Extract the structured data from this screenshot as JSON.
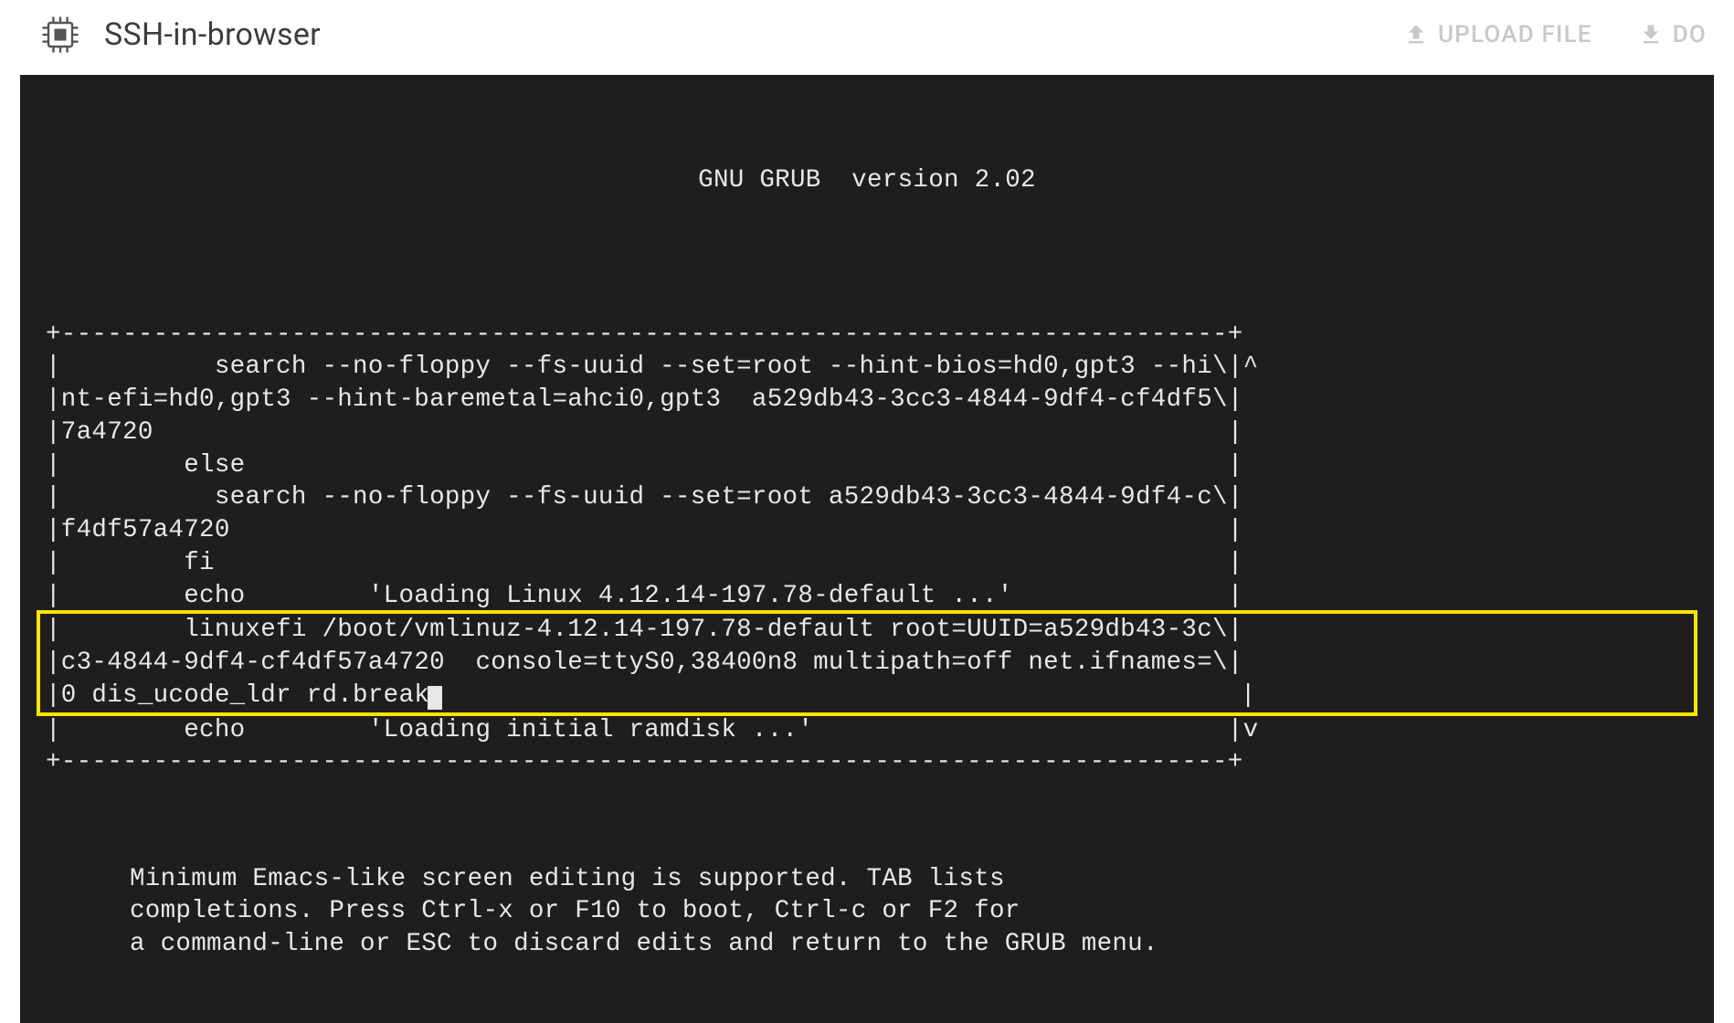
{
  "header": {
    "title": "SSH-in-browser",
    "upload_label": "UPLOAD FILE",
    "download_label": "DO"
  },
  "terminal": {
    "grub_title": "GNU GRUB  version 2.02",
    "border_top": "+----------------------------------------------------------------------------+",
    "line1": "|          search --no-floppy --fs-uuid --set=root --hint-bios=hd0,gpt3 --hi\\|^",
    "line2": "|nt-efi=hd0,gpt3 --hint-baremetal=ahci0,gpt3  a529db43-3cc3-4844-9df4-cf4df5\\|",
    "line3": "|7a4720                                                                      |",
    "line4": "|        else                                                                |",
    "line5": "|          search --no-floppy --fs-uuid --set=root a529db43-3cc3-4844-9df4-c\\|",
    "line6": "|f4df57a4720                                                                 |",
    "line7": "|        fi                                                                  |",
    "line8": "|        echo        'Loading Linux 4.12.14-197.78-default ...'              |",
    "hl1": "|        linuxefi /boot/vmlinuz-4.12.14-197.78-default root=UUID=a529db43-3c\\|",
    "hl2": "|c3-4844-9df4-cf4df57a4720  console=ttyS0,38400n8 multipath=off net.ifnames=\\|",
    "hl3": "|0 dis_ucode_ldr rd.break",
    "hl3_end": "                                                    |",
    "line12": "|        echo        'Loading initial ramdisk ...'                           |v",
    "border_bottom": "+----------------------------------------------------------------------------+",
    "help1": "Minimum Emacs-like screen editing is supported. TAB lists",
    "help2": "completions. Press Ctrl-x or F10 to boot, Ctrl-c or F2 for",
    "help3": "a command-line or ESC to discard edits and return to the GRUB menu."
  }
}
